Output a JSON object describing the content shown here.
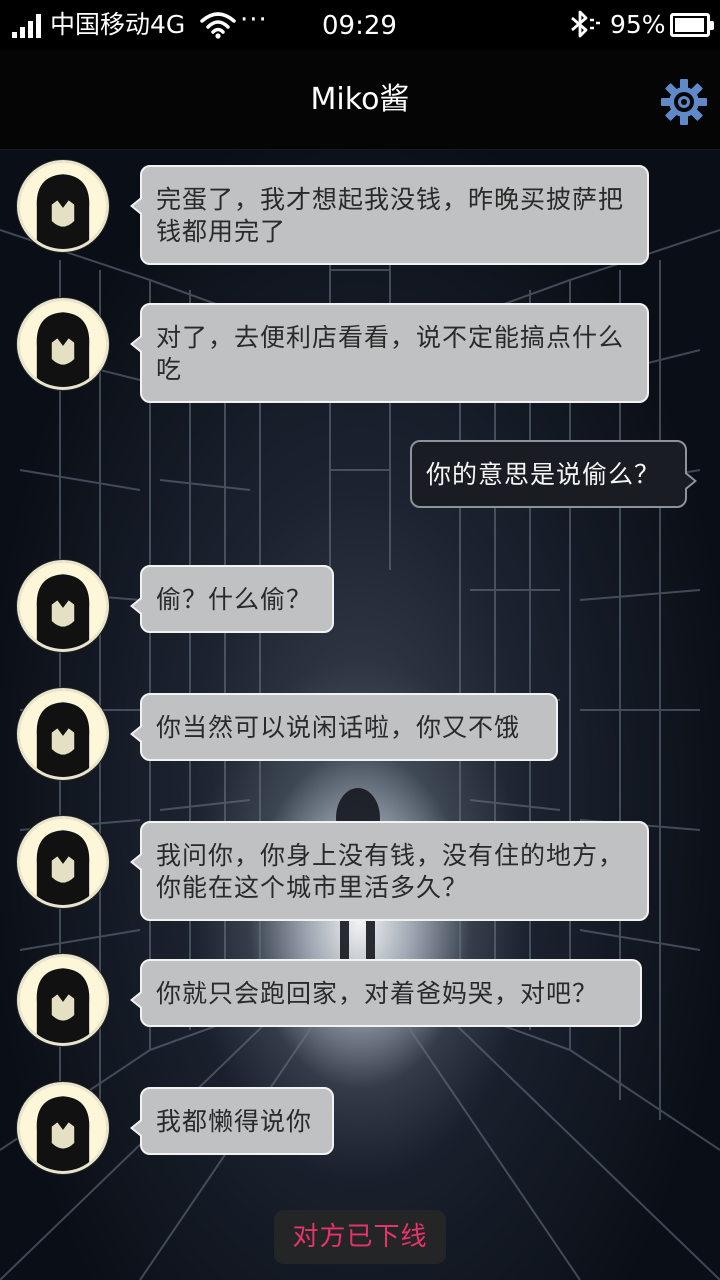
{
  "status_bar": {
    "carrier": "中国移动4G",
    "more": "···",
    "time": "09:29",
    "battery_percent": "95%",
    "battery_level": 0.95,
    "icons": [
      "signal-icon",
      "wifi-icon",
      "bluetooth-icon",
      "battery-icon"
    ]
  },
  "header": {
    "title": "Miko酱",
    "settings_icon": "gear-icon"
  },
  "messages": [
    {
      "from": "other",
      "text": "完蛋了，我才想起我没钱，昨晚买披萨把钱都用完了"
    },
    {
      "from": "other",
      "text": "对了，去便利店看看，说不定能搞点什么吃"
    },
    {
      "from": "me",
      "text": "你的意思是说偷么？"
    },
    {
      "from": "other",
      "text": "偷？什么偷？"
    },
    {
      "from": "other",
      "text": "你当然可以说闲话啦，你又不饿"
    },
    {
      "from": "other",
      "text": "我问你，你身上没有钱，没有住的地方，你能在这个城市里活多久？"
    },
    {
      "from": "other",
      "text": "你就只会跑回家，对着爸妈哭，对吧？"
    },
    {
      "from": "other",
      "text": "我都懒得说你"
    }
  ],
  "system_notice": "对方已下线",
  "colors": {
    "other_bubble": "#c0c1c3",
    "me_bubble": "#1a1c24",
    "offline_text": "#e8336a",
    "settings_icon": "#5f89c9"
  }
}
